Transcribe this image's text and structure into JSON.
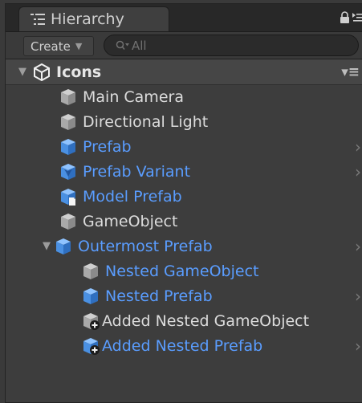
{
  "panel": {
    "tab_title": "Hierarchy",
    "create_label": "Create",
    "search_placeholder": "All"
  },
  "root": {
    "label": "Icons"
  },
  "items": [
    {
      "label": "Main Camera",
      "kind": "gameobject",
      "blue": false
    },
    {
      "label": "Directional Light",
      "kind": "gameobject",
      "blue": false
    },
    {
      "label": "Prefab",
      "kind": "prefab",
      "blue": true
    },
    {
      "label": "Prefab Variant",
      "kind": "prefab-variant",
      "blue": true
    },
    {
      "label": "Model Prefab",
      "kind": "model-prefab",
      "blue": true
    },
    {
      "label": "GameObject",
      "kind": "gameobject",
      "blue": false
    },
    {
      "label": "Outermost Prefab",
      "kind": "prefab",
      "blue": true
    },
    {
      "label": "Nested GameObject",
      "kind": "gameobject",
      "blue": true
    },
    {
      "label": "Nested Prefab",
      "kind": "prefab",
      "blue": true
    },
    {
      "label": "Added Nested GameObject",
      "kind": "added-gameobject",
      "blue": false
    },
    {
      "label": "Added Nested Prefab",
      "kind": "added-prefab",
      "blue": true
    }
  ],
  "colors": {
    "prefab_blue": "#5a9dff",
    "text": "#dcdcdc",
    "background": "#3d3d3d"
  }
}
